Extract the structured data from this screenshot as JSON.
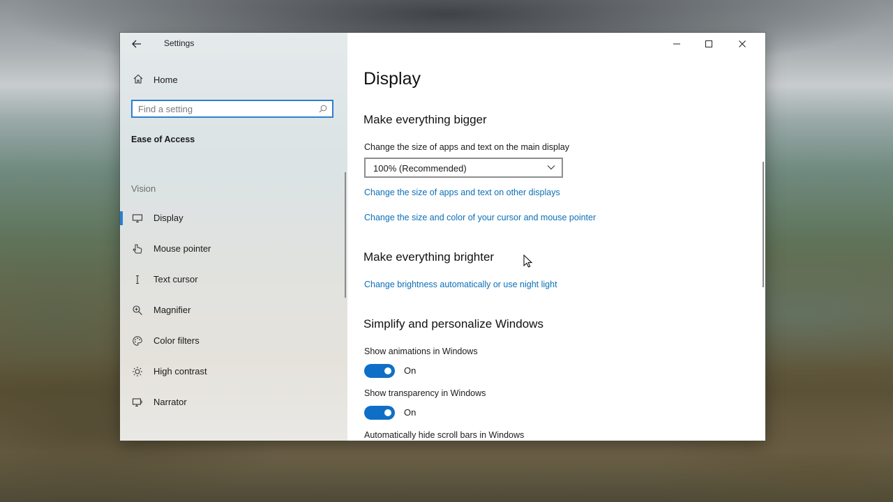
{
  "window": {
    "app_title": "Settings",
    "caption": {
      "minimize": "minimize-icon",
      "maximize": "maximize-icon",
      "close": "close-icon"
    }
  },
  "sidebar": {
    "home_label": "Home",
    "search_placeholder": "Find a setting",
    "search_value": "",
    "category": "Ease of Access",
    "group_label": "Vision",
    "items": [
      {
        "label": "Display",
        "icon": "monitor-icon",
        "selected": true
      },
      {
        "label": "Mouse pointer",
        "icon": "mouse-pointer-icon",
        "selected": false
      },
      {
        "label": "Text cursor",
        "icon": "text-cursor-icon",
        "selected": false
      },
      {
        "label": "Magnifier",
        "icon": "magnifier-icon",
        "selected": false
      },
      {
        "label": "Color filters",
        "icon": "palette-icon",
        "selected": false
      },
      {
        "label": "High contrast",
        "icon": "brightness-icon",
        "selected": false
      },
      {
        "label": "Narrator",
        "icon": "narrator-icon",
        "selected": false
      }
    ]
  },
  "main": {
    "title": "Display",
    "sections": {
      "bigger": {
        "title": "Make everything bigger",
        "size_label": "Change the size of apps and text on the main display",
        "size_value": "100% (Recommended)",
        "link_other_displays": "Change the size of apps and text on other displays",
        "link_cursor": "Change the size and color of your cursor and mouse pointer"
      },
      "brighter": {
        "title": "Make everything brighter",
        "link_brightness": "Change brightness automatically or use night light"
      },
      "simplify": {
        "title": "Simplify and personalize Windows",
        "animations_label": "Show animations in Windows",
        "animations_state": "On",
        "transparency_label": "Show transparency in Windows",
        "transparency_state": "On",
        "scrollbars_label": "Automatically hide scroll bars in Windows"
      }
    }
  },
  "colors": {
    "accent": "#0f6fc6",
    "link": "#0b6fb6",
    "search_border": "#2b7fd4"
  }
}
